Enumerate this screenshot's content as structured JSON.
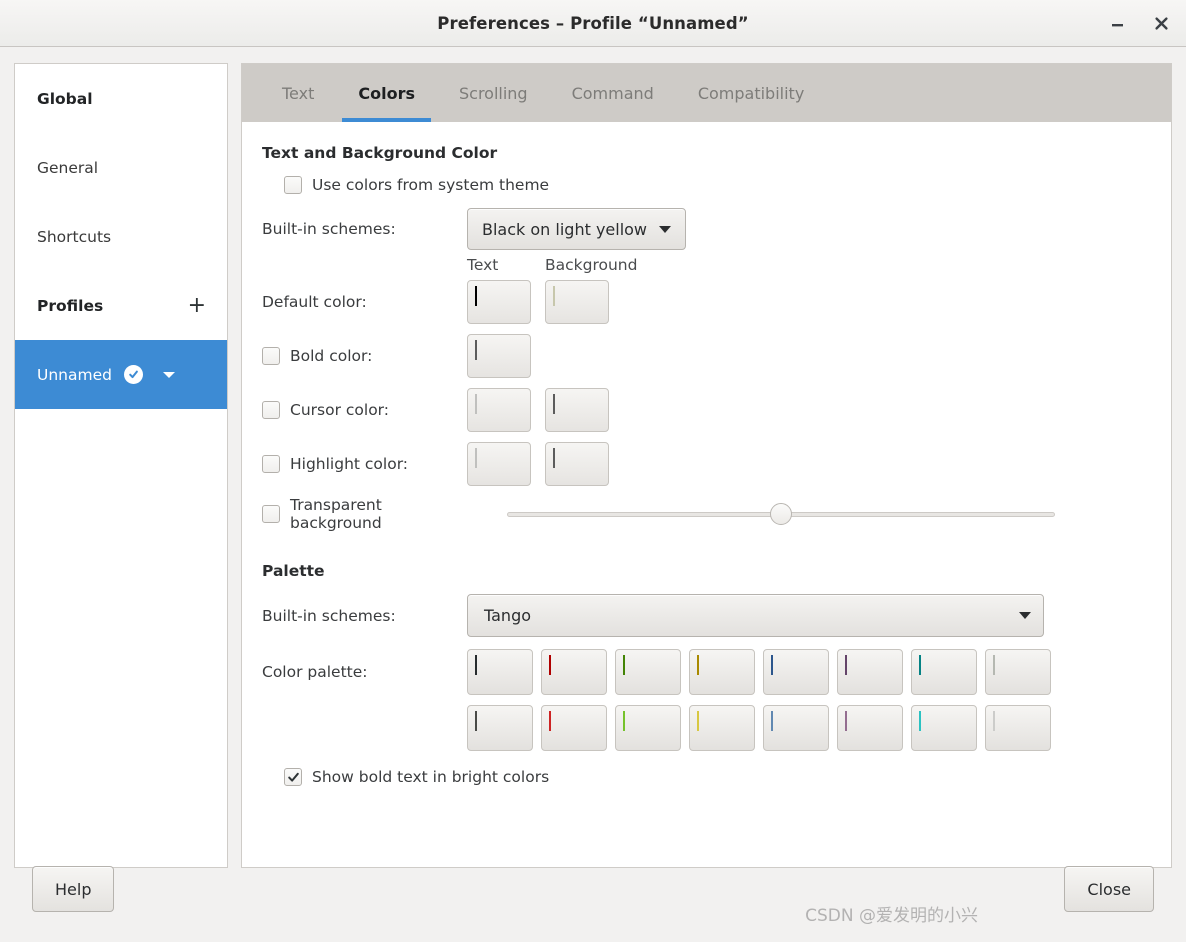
{
  "window": {
    "title": "Preferences – Profile “Unnamed”",
    "minimize_icon": "minimize-icon",
    "close_icon": "close-icon"
  },
  "sidebar": {
    "items": [
      {
        "label": "Global",
        "type": "header",
        "selected": false
      },
      {
        "label": "General",
        "type": "item",
        "selected": false
      },
      {
        "label": "Shortcuts",
        "type": "item",
        "selected": false
      },
      {
        "label": "Profiles",
        "type": "header",
        "selected": false,
        "add_label": "+"
      },
      {
        "label": "Unnamed",
        "type": "profile",
        "selected": true,
        "default_badge": "check-icon",
        "menu": "chevron-down-icon"
      }
    ]
  },
  "tabs": [
    {
      "label": "Text",
      "active": false
    },
    {
      "label": "Colors",
      "active": true
    },
    {
      "label": "Scrolling",
      "active": false
    },
    {
      "label": "Command",
      "active": false
    },
    {
      "label": "Compatibility",
      "active": false
    }
  ],
  "text_background": {
    "section_title": "Text and Background Color",
    "use_system_theme": {
      "label": "Use colors from system theme",
      "checked": false
    },
    "builtin_schemes": {
      "label": "Built-in schemes:",
      "value": "Black on light yellow"
    },
    "column_headers": {
      "text": "Text",
      "background": "Background"
    },
    "rows": [
      {
        "label": "Default color:",
        "has_checkbox": false,
        "checked": false,
        "text_color": "#000000",
        "bg_color": "#FFFFDD"
      },
      {
        "label": "Bold color:",
        "has_checkbox": true,
        "checked": false,
        "text_color": "#767676",
        "bg_color": null
      },
      {
        "label": "Cursor color:",
        "has_checkbox": true,
        "checked": false,
        "text_color": "#F6F6F4",
        "bg_color": "#767676"
      },
      {
        "label": "Highlight color:",
        "has_checkbox": true,
        "checked": false,
        "text_color": "#F6F6F4",
        "bg_color": "#767676"
      }
    ],
    "transparent_background": {
      "label": "Transparent background",
      "checked": false,
      "slider_percent": 50
    }
  },
  "palette": {
    "section_title": "Palette",
    "builtin_schemes": {
      "label": "Built-in schemes:",
      "value": "Tango"
    },
    "color_palette_label": "Color palette:",
    "colors_row1": [
      "#2E3436",
      "#CC0000",
      "#4E9A06",
      "#C4A000",
      "#3465A4",
      "#75507B",
      "#06989A",
      "#D3D7CF"
    ],
    "colors_row2": [
      "#555753",
      "#EF2929",
      "#8AE234",
      "#FCE94F",
      "#729FCF",
      "#AD7FA8",
      "#34E2E2",
      "#EEEEEC"
    ],
    "show_bold_bright": {
      "label": "Show bold text in bright colors",
      "checked": true
    }
  },
  "footer": {
    "help_label": "Help",
    "close_label": "Close"
  },
  "watermark": "CSDN @爱发明的小兴",
  "theme": {
    "accent": "#3d8bd4",
    "tabbar_bg": "#cecbc7",
    "window_bg": "#f2f1f0"
  }
}
